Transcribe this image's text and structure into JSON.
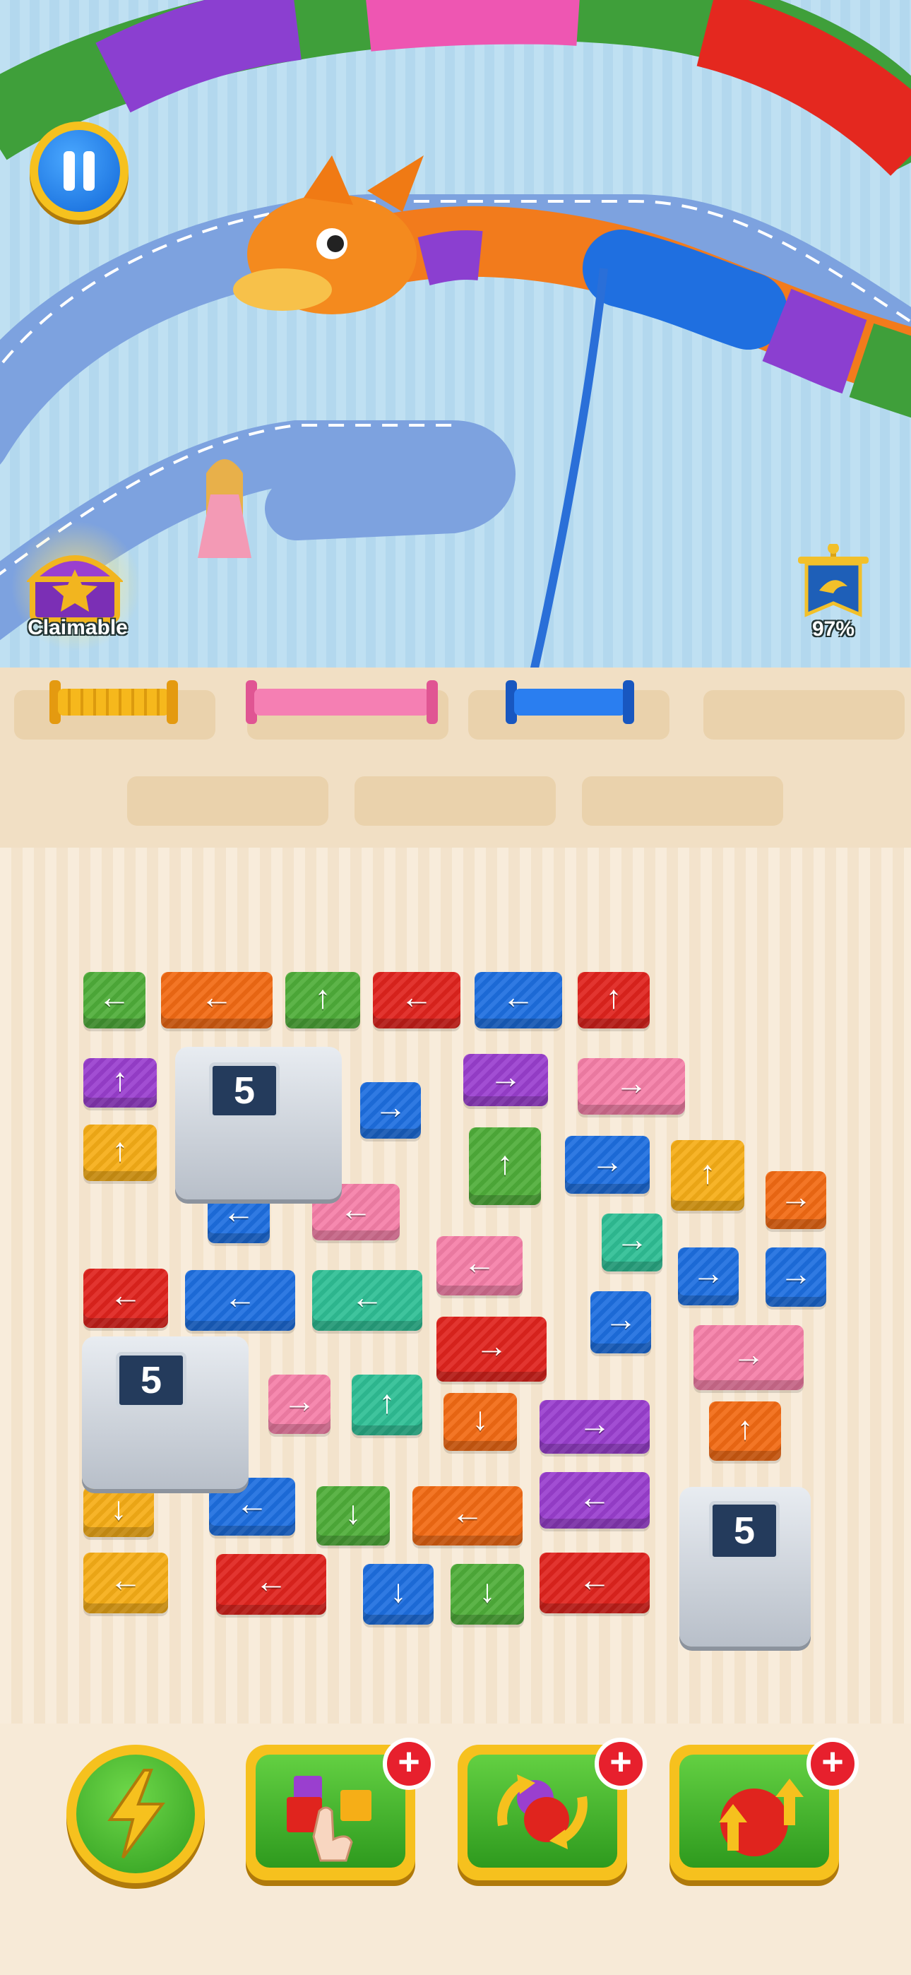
{
  "hud": {
    "chest_label": "Claimable",
    "level_progress": "97%",
    "level_progress_value": 0.97
  },
  "colors": {
    "red": "#e0241e",
    "orange": "#f26a14",
    "yellow": "#f6ae17",
    "green": "#4fae3a",
    "teal": "#2fbf95",
    "blue": "#1e6fe0",
    "purple": "#9a3fcf",
    "pink": "#f57fa8"
  },
  "spools": [
    {
      "color": "yellow",
      "state": "wound"
    },
    {
      "color": "pink",
      "state": "wound"
    },
    {
      "color": "blue",
      "state": "winding"
    },
    {
      "color": "",
      "state": "empty"
    }
  ],
  "reserve_slots": 3,
  "arrows": {
    "left": "←",
    "right": "→",
    "up": "↑",
    "down": "↓"
  },
  "dispensers": [
    {
      "count": "5"
    },
    {
      "count": "5"
    },
    {
      "count": "5"
    }
  ],
  "tiles": [
    {
      "color": "green",
      "dir": "left"
    },
    {
      "color": "orange",
      "dir": "left"
    },
    {
      "color": "green",
      "dir": "up"
    },
    {
      "color": "red",
      "dir": "left"
    },
    {
      "color": "blue",
      "dir": "left"
    },
    {
      "color": "red",
      "dir": "up"
    },
    {
      "color": "purple",
      "dir": "up"
    },
    {
      "color": "purple",
      "dir": "right"
    },
    {
      "color": "pink",
      "dir": "right"
    },
    {
      "color": "yellow",
      "dir": "up"
    },
    {
      "color": "blue",
      "dir": "right"
    },
    {
      "color": "green",
      "dir": "up"
    },
    {
      "color": "blue",
      "dir": "right"
    },
    {
      "color": "yellow",
      "dir": "up"
    },
    {
      "color": "orange",
      "dir": "right"
    },
    {
      "color": "blue",
      "dir": "left"
    },
    {
      "color": "pink",
      "dir": "left"
    },
    {
      "color": "teal",
      "dir": "right"
    },
    {
      "color": "pink",
      "dir": "left"
    },
    {
      "color": "blue",
      "dir": "right"
    },
    {
      "color": "blue",
      "dir": "right"
    },
    {
      "color": "red",
      "dir": "left"
    },
    {
      "color": "blue",
      "dir": "left"
    },
    {
      "color": "teal",
      "dir": "left"
    },
    {
      "color": "blue",
      "dir": "right"
    },
    {
      "color": "red",
      "dir": "right"
    },
    {
      "color": "pink",
      "dir": "right"
    },
    {
      "color": "pink",
      "dir": "right"
    },
    {
      "color": "teal",
      "dir": "up"
    },
    {
      "color": "orange",
      "dir": "down"
    },
    {
      "color": "purple",
      "dir": "right"
    },
    {
      "color": "orange",
      "dir": "up"
    },
    {
      "color": "yellow",
      "dir": "down"
    },
    {
      "color": "blue",
      "dir": "left"
    },
    {
      "color": "green",
      "dir": "down"
    },
    {
      "color": "orange",
      "dir": "left"
    },
    {
      "color": "purple",
      "dir": "left"
    },
    {
      "color": "yellow",
      "dir": "left"
    },
    {
      "color": "red",
      "dir": "left"
    },
    {
      "color": "blue",
      "dir": "down"
    },
    {
      "color": "green",
      "dir": "down"
    },
    {
      "color": "red",
      "dir": "left"
    }
  ],
  "boosters": [
    {
      "name": "lightning-icon",
      "has_plus": false
    },
    {
      "name": "tap-select-icon",
      "has_plus": true
    },
    {
      "name": "shuffle-icon",
      "has_plus": true
    },
    {
      "name": "yarn-upgrade-icon",
      "has_plus": true
    }
  ],
  "plus_symbol": "+"
}
